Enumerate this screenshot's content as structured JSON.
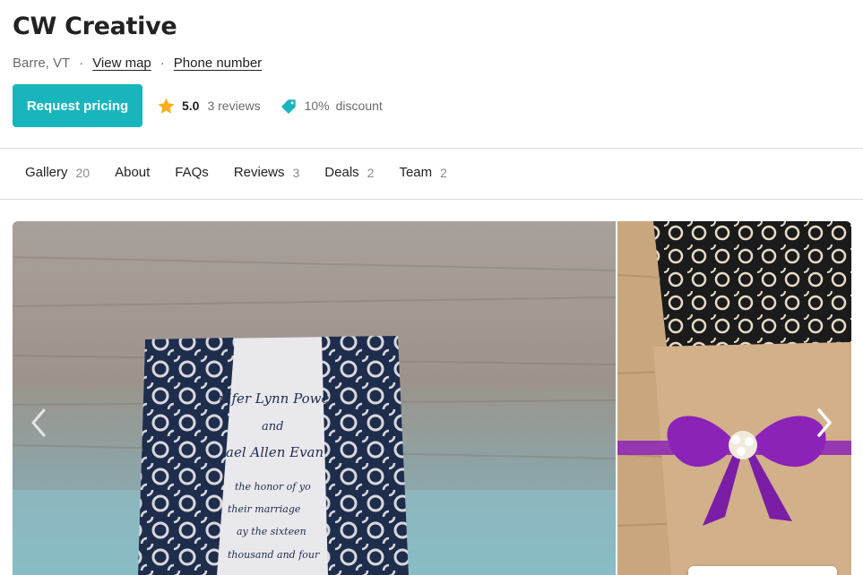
{
  "vendor": {
    "name": "CW Creative",
    "location": "Barre, VT",
    "separator": "·",
    "view_map_label": "View map",
    "phone_label": "Phone number"
  },
  "actions": {
    "request_label": "Request pricing",
    "rating_score": "5.0",
    "rating_reviews": "3 reviews",
    "discount_pct": "10%",
    "discount_label": "discount"
  },
  "tabs": [
    {
      "label": "Gallery",
      "count": "20"
    },
    {
      "label": "About",
      "count": ""
    },
    {
      "label": "FAQs",
      "count": ""
    },
    {
      "label": "Reviews",
      "count": "3"
    },
    {
      "label": "Deals",
      "count": "2"
    },
    {
      "label": "Team",
      "count": "2"
    }
  ],
  "gallery": {
    "main_photo": {
      "subject": "navy laser-cut wedding invitation",
      "card_lines": [
        "Jennifer Lynn Power",
        "and",
        "Michael Allen Evans"
      ]
    },
    "side_photo": {
      "subject": "black lace invitation with purple ribbon bow"
    }
  },
  "icons": {
    "star": "star-icon",
    "tag": "discount-tag-icon",
    "prev": "chevron-left-icon",
    "next": "chevron-right-icon"
  },
  "colors": {
    "accent": "#19b5bc",
    "star": "#f5b01a",
    "text": "#222222",
    "muted": "#6b6b6b"
  }
}
